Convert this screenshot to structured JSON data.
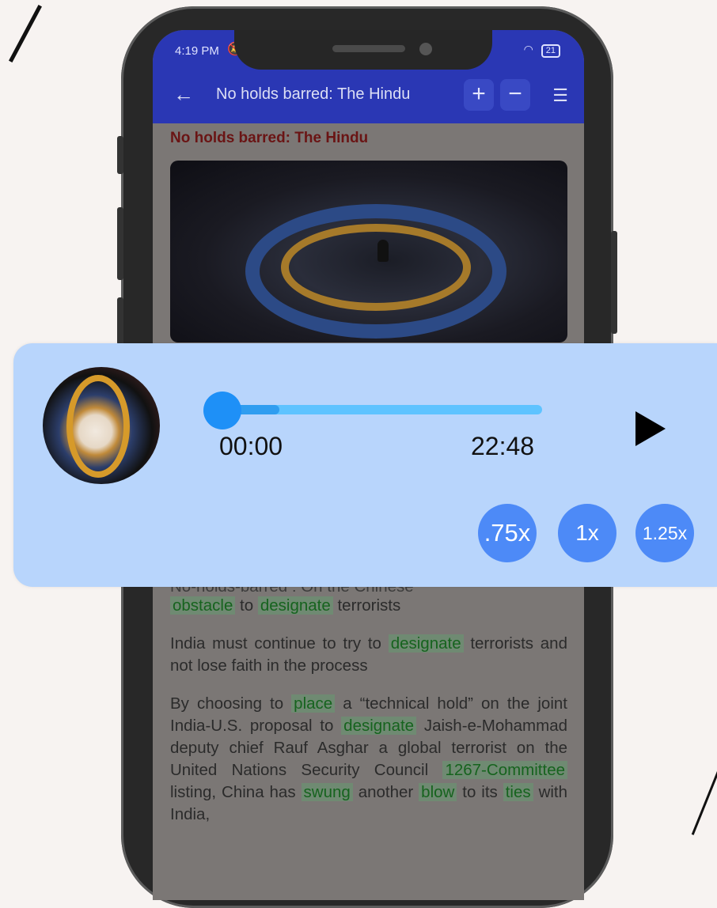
{
  "status_bar": {
    "time": "4:19 PM",
    "bell_muted_icon": "bell-off-icon",
    "wifi_icon": "wifi-icon",
    "battery": "21"
  },
  "app_bar": {
    "back_icon": "arrow-left-icon",
    "title": "No holds barred: The Hindu",
    "zoom_in_label": "+",
    "zoom_out_label": "−",
    "menu_icon": "list-icon"
  },
  "article": {
    "heading": "No holds barred: The Hindu",
    "image_alt_icon": "council-chamber-photo",
    "partial_line": "No-holds-barred : On the Chinese",
    "p1_before": "",
    "p1_kw1": "obstacle",
    "p1_mid": " to ",
    "p1_kw2": "designate",
    "p1_after": " terrorists",
    "p2_start": "India must continue to try to ",
    "p2_kw": "designate",
    "p2_end": " terrorists and not lose faith in the process",
    "p3_a": "By choosing to ",
    "p3_kw1": "place",
    "p3_b": " a “technical hold” on the joint India-U.S. proposal to ",
    "p3_kw2": "designate",
    "p3_c": " Jaish-e-Mohammad deputy chief Rauf Asghar a global terrorist on the United Nations Security Council ",
    "p3_kw3": "1267-Committee",
    "p3_d": " listing, China has ",
    "p3_kw4": "swung",
    "p3_e": " another ",
    "p3_kw5": "blow",
    "p3_f": " to its ",
    "p3_kw6": "ties",
    "p3_g": " with India,"
  },
  "player": {
    "thumbnail_icon": "episode-thumbnail",
    "current_time": "00:00",
    "total_time": "22:48",
    "progress": 0.0,
    "buffered": 0.18,
    "play_icon": "play-icon",
    "speeds": [
      ".75x",
      "1x",
      "1.25x"
    ],
    "colors": {
      "panel": "#b8d5fc",
      "knob": "#1e90f7",
      "speed_button": "#4d8af7"
    }
  }
}
